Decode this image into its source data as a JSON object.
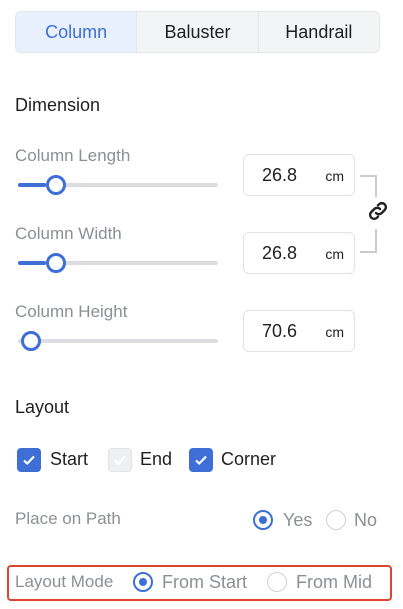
{
  "tabs": [
    {
      "label": "Column",
      "active": true
    },
    {
      "label": "Baluster",
      "active": false
    },
    {
      "label": "Handrail",
      "active": false
    }
  ],
  "dimension": {
    "title": "Dimension",
    "fields": [
      {
        "label": "Column Length",
        "value": "26.8",
        "unit": "cm",
        "slider_fraction": 0.19
      },
      {
        "label": "Column Width",
        "value": "26.8",
        "unit": "cm",
        "slider_fraction": 0.19
      },
      {
        "label": "Column Height",
        "value": "70.6",
        "unit": "cm",
        "slider_fraction": 0.0
      }
    ],
    "link_icon": "link-icon"
  },
  "layout": {
    "title": "Layout",
    "checks": [
      {
        "label": "Start",
        "checked": true,
        "disabled": false
      },
      {
        "label": "End",
        "checked": true,
        "disabled": true
      },
      {
        "label": "Corner",
        "checked": true,
        "disabled": false
      }
    ],
    "place_on_path": {
      "label": "Place on Path",
      "options": [
        {
          "label": "Yes",
          "selected": true
        },
        {
          "label": "No",
          "selected": false
        }
      ]
    },
    "layout_mode": {
      "label": "Layout Mode",
      "options": [
        {
          "label": "From Start",
          "selected": true
        },
        {
          "label": "From Mid",
          "selected": false
        }
      ]
    }
  },
  "colors": {
    "accent": "#3d6fd6",
    "highlight": "#d9472e"
  }
}
